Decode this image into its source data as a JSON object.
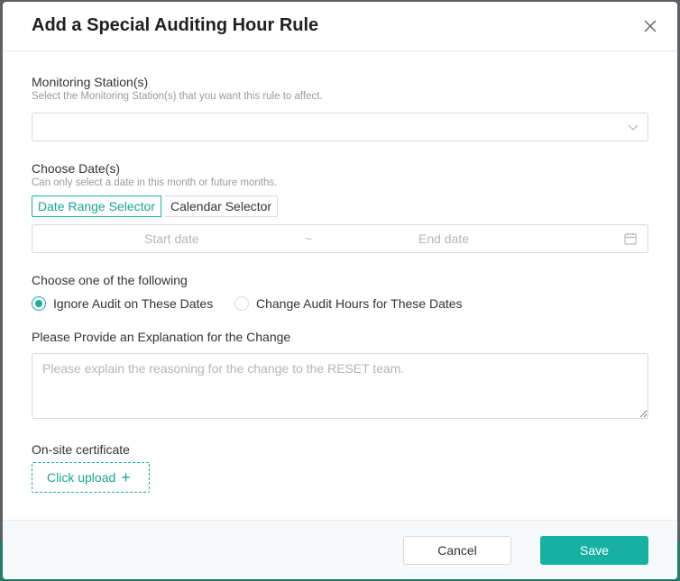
{
  "modal": {
    "title": "Add a Special Auditing Hour Rule"
  },
  "stations": {
    "label": "Monitoring Station(s)",
    "hint": "Select the Monitoring Station(s) that you want this rule to affect."
  },
  "dates": {
    "label": "Choose Date(s)",
    "hint": "Can only select a date in this month or future months.",
    "tabs": [
      "Date Range Selector",
      "Calendar Selector"
    ],
    "active_tab": "Date Range Selector",
    "start_placeholder": "Start date",
    "separator": "~",
    "end_placeholder": "End date"
  },
  "options": {
    "label": "Choose one of the following",
    "choices": [
      "Ignore Audit on These Dates",
      "Change Audit Hours for These Dates"
    ],
    "selected": "Ignore Audit on These Dates"
  },
  "explanation": {
    "label": "Please Provide an Explanation for the Change",
    "placeholder": "Please explain the reasoning for the change to the RESET team.",
    "value": ""
  },
  "certificate": {
    "label": "On-site certificate",
    "upload_label": "Click upload",
    "upload_icon": "+"
  },
  "footer": {
    "cancel_label": "Cancel",
    "save_label": "Save"
  },
  "colors": {
    "accent": "#17b1a2",
    "border": "#d9d9d9",
    "placeholder": "#b5b5b5"
  },
  "icons": {
    "close": "close-icon",
    "dropdown": "chevron-down-icon",
    "calendar": "calendar-icon",
    "upload": "plus-icon"
  }
}
